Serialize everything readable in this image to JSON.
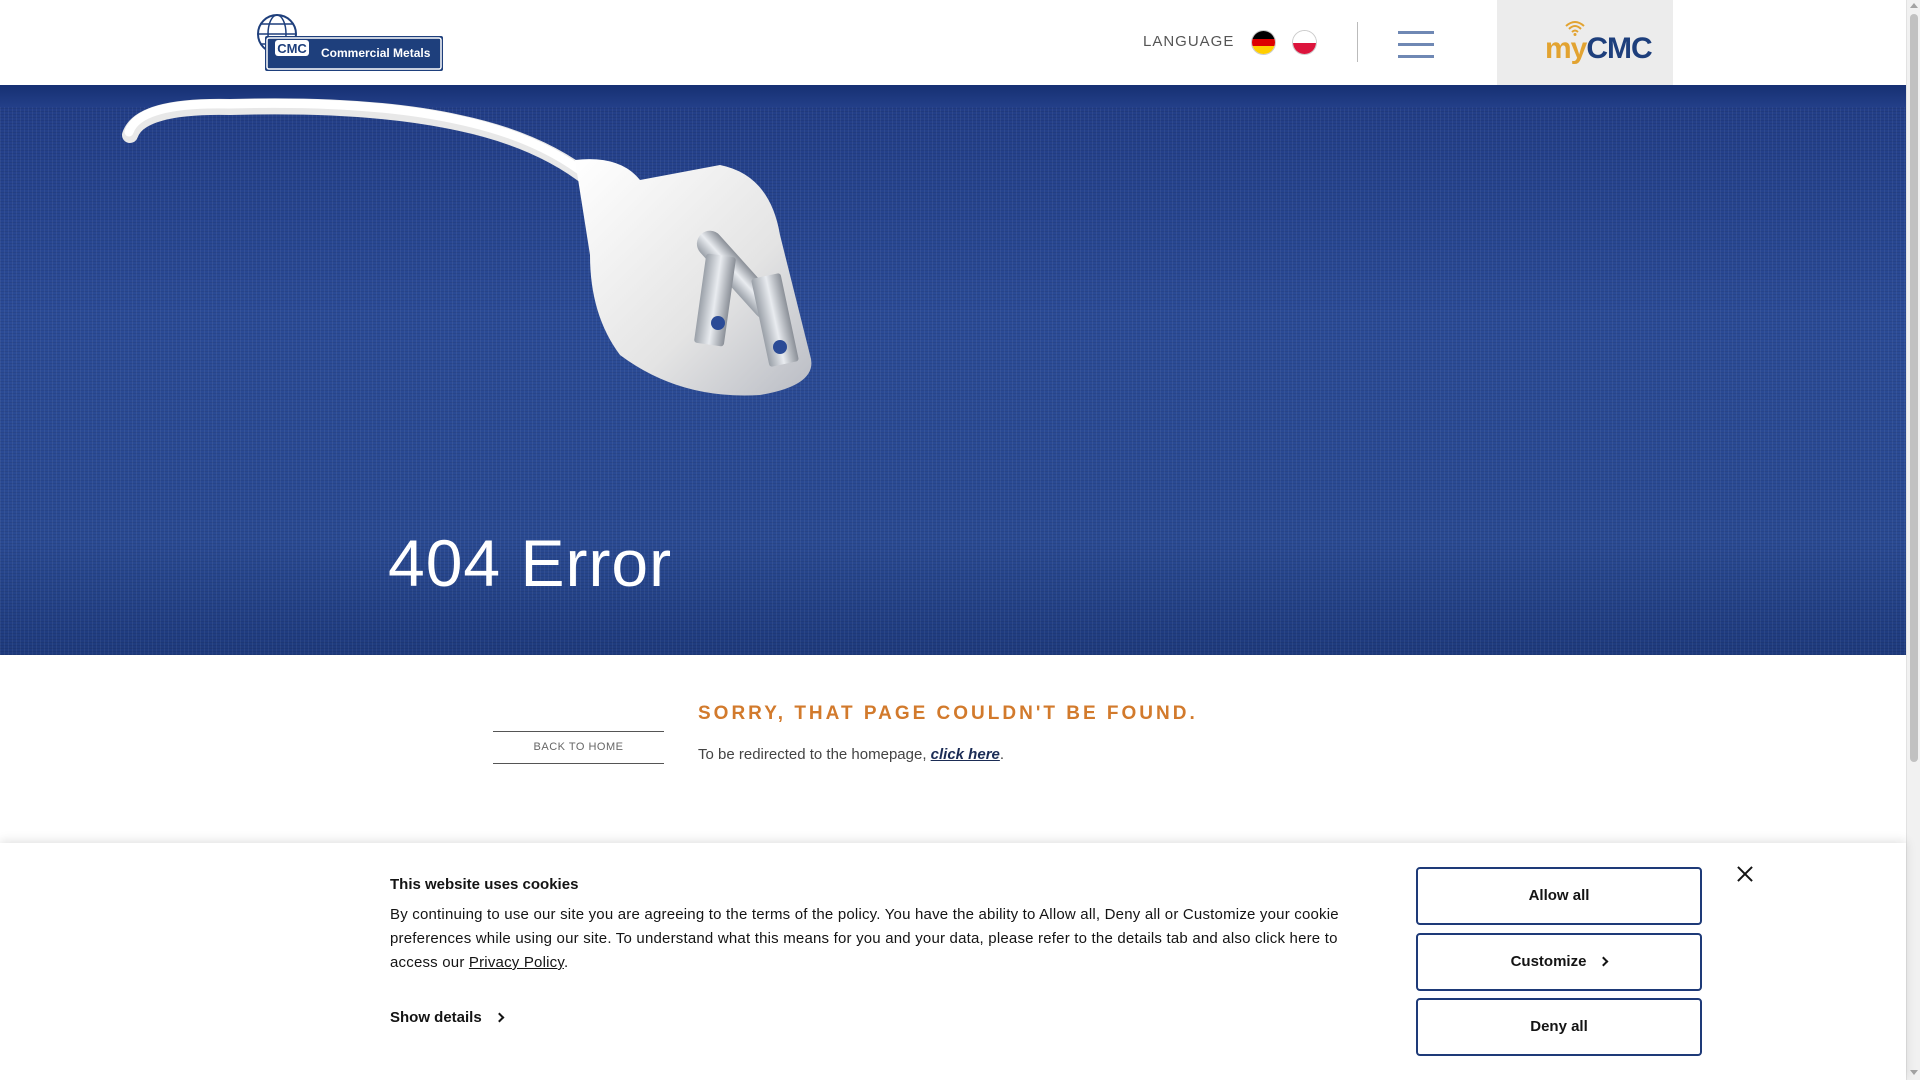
{
  "header": {
    "logo_text": "CMC Commercial Metals",
    "language_label": "LANGUAGE",
    "languages": [
      {
        "code": "de",
        "icon": "germany-flag-icon"
      },
      {
        "code": "pl",
        "icon": "poland-flag-icon"
      }
    ],
    "mycmc": {
      "prefix": "my",
      "name": "CMC"
    }
  },
  "hero": {
    "title": "404 Error"
  },
  "content": {
    "back_home": "BACK TO HOME",
    "heading": "SORRY, THAT PAGE COULDN'T BE FOUND.",
    "redirect_prefix": "To be redirected to the homepage, ",
    "redirect_link": "click here",
    "redirect_suffix": "."
  },
  "cookie": {
    "title": "This website uses cookies",
    "body": "By continuing to use our site you are agreeing to the terms of the policy. You have the ability to Allow all, Deny all or Customize your cookie preferences while using our site. To understand what this means for you and your data, please refer to the details tab and also click here to access our ",
    "privacy_link": "Privacy Policy",
    "body_end": ".",
    "show_details": "Show details",
    "allow_all": "Allow all",
    "customize": "Customize",
    "deny_all": "Deny all"
  },
  "colors": {
    "brand_blue": "#1e3f7c",
    "accent_orange": "#d27a2c",
    "mycmc_gold": "#e2a331"
  }
}
